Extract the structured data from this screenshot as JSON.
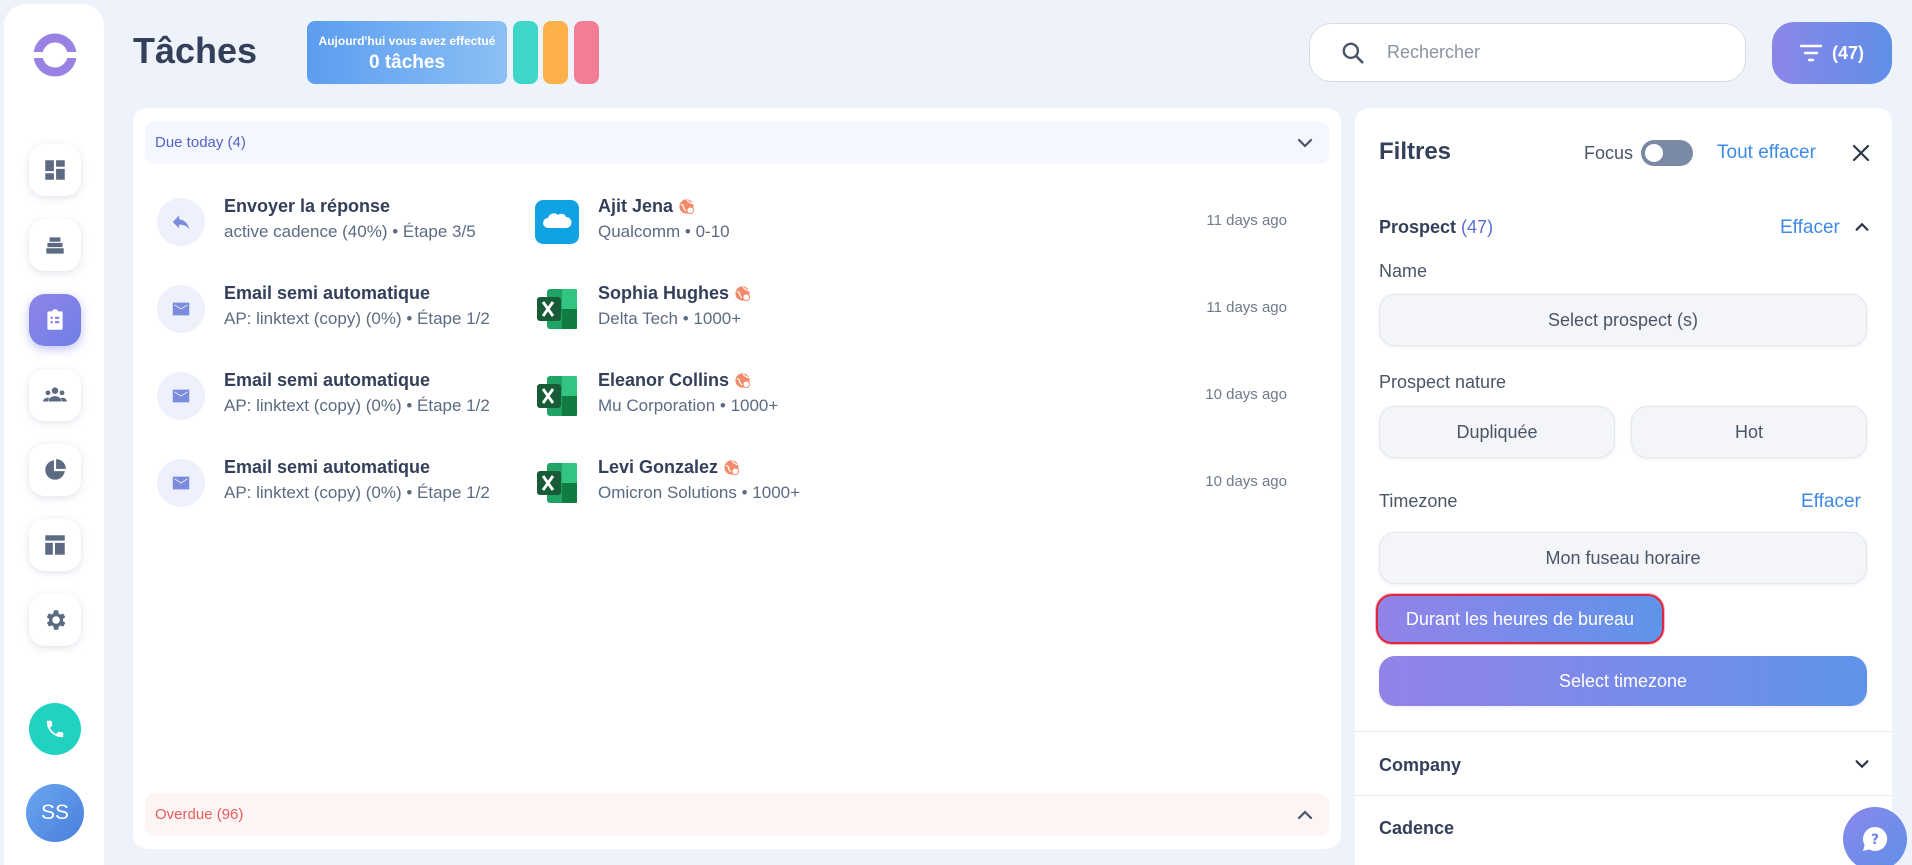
{
  "header": {
    "title": "Tâches",
    "stat_line1": "Aujourd'hui vous avez effectué",
    "stat_line2": "0 tâches",
    "search_placeholder": "Rechercher",
    "filter_count": "(47)"
  },
  "colors": {
    "accent": "#6f7fe6",
    "teal": "#3dd6c9",
    "orange": "#fcb04a",
    "pink": "#f47d96",
    "overdue": "#e85c5c",
    "link": "#3d8ae6"
  },
  "sections": {
    "due_today": "Due today (4)",
    "overdue": "Overdue (96)"
  },
  "tasks": [
    {
      "icon": "reply-icon",
      "title": "Envoyer la réponse",
      "subtitle": "active cadence (40%) • Étape 3/5",
      "logo": "salesforce-icon",
      "prospect": "Ajit Jena",
      "company": "Qualcomm • 0-10",
      "time": "11 days ago"
    },
    {
      "icon": "mail-icon",
      "title": "Email semi automatique",
      "subtitle": "AP: linktext (copy) (0%) • Étape 1/2",
      "logo": "excel-icon",
      "prospect": "Sophia Hughes",
      "company": "Delta Tech • 1000+",
      "time": "11 days ago"
    },
    {
      "icon": "mail-icon",
      "title": "Email semi automatique",
      "subtitle": "AP: linktext (copy) (0%) • Étape 1/2",
      "logo": "excel-icon",
      "prospect": "Eleanor Collins",
      "company": "Mu Corporation • 1000+",
      "time": "10 days ago"
    },
    {
      "icon": "mail-icon",
      "title": "Email semi automatique",
      "subtitle": "AP: linktext (copy) (0%) • Étape 1/2",
      "logo": "excel-icon",
      "prospect": "Levi Gonzalez",
      "company": "Omicron Solutions • 1000+",
      "time": "10 days ago"
    }
  ],
  "filters": {
    "title": "Filtres",
    "focus_label": "Focus",
    "clear_all": "Tout effacer",
    "prospect_label": "Prospect",
    "prospect_count": "(47)",
    "clear": "Effacer",
    "name_label": "Name",
    "select_prospect": "Select prospect (s)",
    "nature_label": "Prospect nature",
    "nature_options": [
      "Dupliquée",
      "Hot"
    ],
    "timezone_label": "Timezone",
    "my_timezone": "Mon fuseau horaire",
    "office_hours": "Durant les heures de bureau",
    "select_timezone": "Select timezone",
    "company_label": "Company",
    "cadence_label": "Cadence"
  },
  "user": {
    "initials": "SS"
  }
}
